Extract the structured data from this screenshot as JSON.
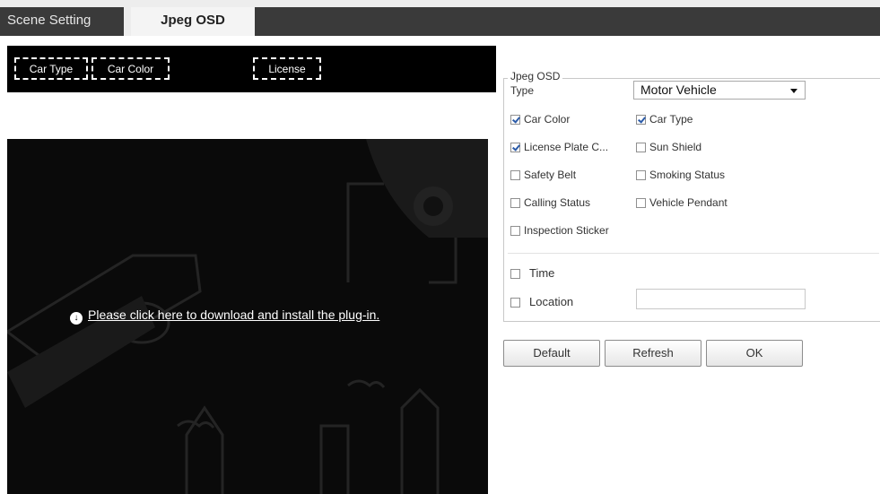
{
  "tabs": [
    {
      "label": "Scene Setting",
      "active": false
    },
    {
      "label": "Jpeg OSD",
      "active": true
    }
  ],
  "osd_preview": {
    "labels": [
      "Car Type",
      "Car Color",
      "License"
    ]
  },
  "video": {
    "plugin_prompt": "Please click here to download and install the plug-in.",
    "icon": "download-arrow-icon"
  },
  "jpeg_osd": {
    "legend": "Jpeg OSD",
    "type_label": "Type",
    "type_value": "Motor Vehicle",
    "options": [
      {
        "label": "Car Color",
        "checked": true
      },
      {
        "label": "Car Type",
        "checked": true
      },
      {
        "label": "License Plate C...",
        "checked": true
      },
      {
        "label": "Sun Shield",
        "checked": false
      },
      {
        "label": "Safety Belt",
        "checked": false
      },
      {
        "label": "Smoking Status",
        "checked": false
      },
      {
        "label": "Calling Status",
        "checked": false
      },
      {
        "label": "Vehicle Pendant",
        "checked": false
      },
      {
        "label": "Inspection Sticker",
        "checked": false
      }
    ],
    "time": {
      "label": "Time",
      "checked": false
    },
    "location": {
      "label": "Location",
      "checked": false,
      "value": ""
    }
  },
  "buttons": {
    "default": "Default",
    "refresh": "Refresh",
    "ok": "OK"
  },
  "colors": {
    "tab_dark": "#3a3a3a",
    "video_bg": "#0a0a0a",
    "check_blue": "#2a5aa8"
  }
}
